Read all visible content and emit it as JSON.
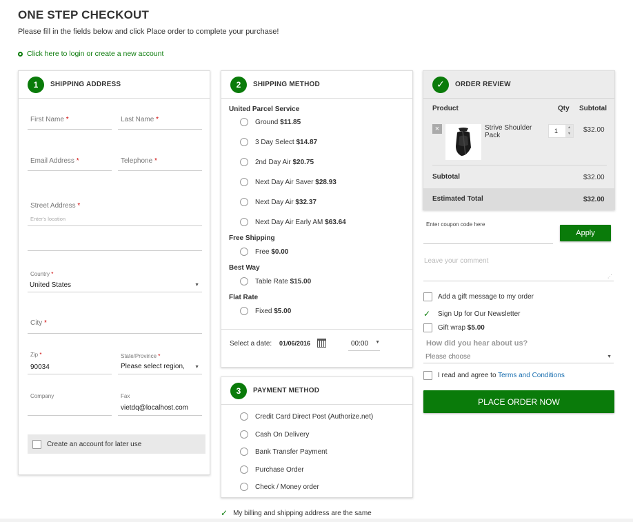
{
  "page": {
    "title": "ONE STEP CHECKOUT",
    "subtitle": "Please fill in the fields below and click Place order to complete your purchase!",
    "login_link": "Click here to login or create a new account"
  },
  "shipping_address": {
    "step": "1",
    "title": "SHIPPING ADDRESS",
    "first_name": "First Name",
    "last_name": "Last Name",
    "email": "Email Address",
    "telephone": "Telephone",
    "street": "Street Address",
    "street_placeholder": "Enter's location",
    "country_label": "Country",
    "country_value": "United States",
    "city": "City",
    "zip_label": "Zip",
    "zip_value": "90034",
    "state_label": "State/Province",
    "state_value": "Please select region,",
    "company_label": "Company",
    "fax_label": "Fax",
    "fax_value": "vietdq@localhost.com",
    "create_account": "Create an account for later use",
    "required_mark": "*"
  },
  "shipping_method": {
    "step": "2",
    "title": "SHIPPING METHOD",
    "groups": [
      {
        "name": "United Parcel Service",
        "options": [
          {
            "label": "Ground",
            "price": "$11.85"
          },
          {
            "label": "3 Day Select",
            "price": "$14.87"
          },
          {
            "label": "2nd Day Air",
            "price": "$20.75"
          },
          {
            "label": "Next Day Air Saver",
            "price": "$28.93"
          },
          {
            "label": "Next Day Air",
            "price": "$32.37"
          },
          {
            "label": "Next Day Air Early AM",
            "price": "$63.64"
          }
        ]
      },
      {
        "name": "Free Shipping",
        "options": [
          {
            "label": "Free",
            "price": "$0.00"
          }
        ]
      },
      {
        "name": "Best Way",
        "options": [
          {
            "label": "Table Rate",
            "price": "$15.00"
          }
        ]
      },
      {
        "name": "Flat Rate",
        "options": [
          {
            "label": "Fixed",
            "price": "$5.00"
          }
        ]
      }
    ],
    "date_label": "Select a date:",
    "date_value": "01/06/2016",
    "time_value": "00:00"
  },
  "payment_method": {
    "step": "3",
    "title": "PAYMENT METHOD",
    "options": [
      "Credit Card Direct Post (Authorize.net)",
      "Cash On Delivery",
      "Bank Transfer Payment",
      "Purchase Order",
      "Check / Money order"
    ]
  },
  "billing_same": "My billing and shipping address are the same",
  "order_review": {
    "title": "ORDER REVIEW",
    "col_product": "Product",
    "col_qty": "Qty",
    "col_subtotal": "Subtotal",
    "item": {
      "name": "Strive Shoulder Pack",
      "qty": "1",
      "subtotal": "$32.00"
    },
    "subtotal_label": "Subtotal",
    "subtotal_value": "$32.00",
    "total_label": "Estimated Total",
    "total_value": "$32.00"
  },
  "sidebar": {
    "coupon_placeholder": "Enter coupon code here",
    "apply": "Apply",
    "comment_placeholder": "Leave your comment",
    "gift_message": "Add a gift message to my order",
    "newsletter": "Sign Up for Our Newsletter",
    "gift_wrap": "Gift wrap",
    "gift_wrap_price": "$5.00",
    "hear_about": "How did you hear about us?",
    "hear_placeholder": "Please choose",
    "terms_prefix": "I read and agree to",
    "terms_link": "Terms and Conditions",
    "place_order": "PLACE ORDER NOW"
  },
  "colors": {
    "accent": "#0a7b0a"
  }
}
